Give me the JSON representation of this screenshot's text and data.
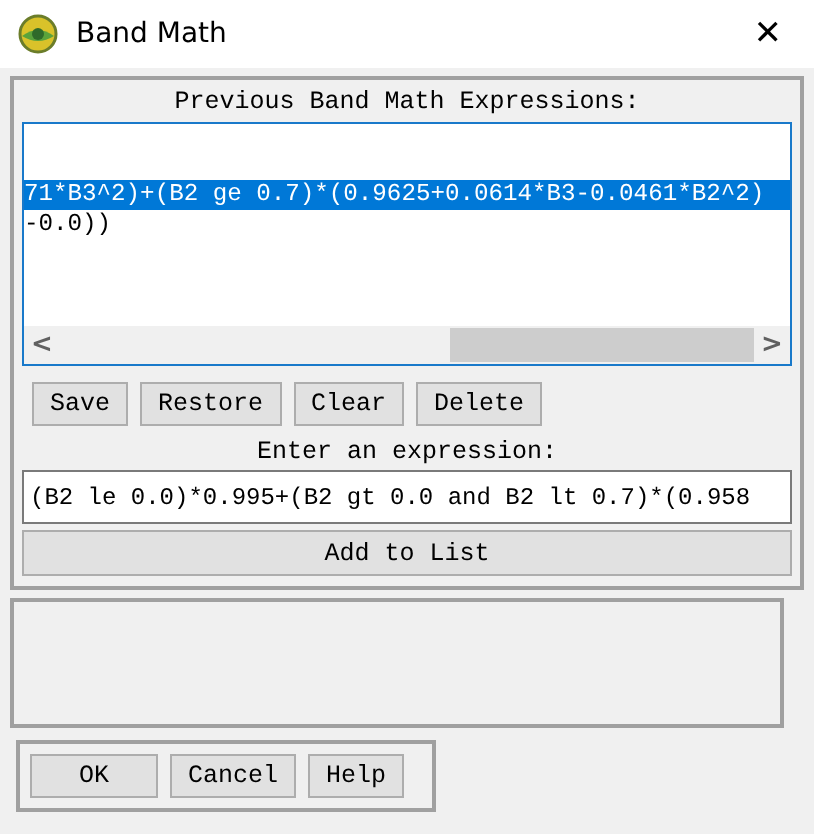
{
  "window": {
    "title": "Band Math",
    "close": "✕"
  },
  "history": {
    "heading": "Previous Band Math Expressions:",
    "items": [
      {
        "text": "71*B3^2)+(B2 ge 0.7)*(0.9625+0.0614*B3-0.0461*B2^2)",
        "selected": true
      },
      {
        "text": "-0.0))",
        "selected": false
      }
    ],
    "scroll_left": "<",
    "scroll_right": ">",
    "buttons": [
      "Save",
      "Restore",
      "Clear",
      "Delete"
    ]
  },
  "expression": {
    "label": "Enter an expression:",
    "value": "(B2 le 0.0)*0.995+(B2 gt 0.0 and B2 lt 0.7)*(0.958",
    "add_button": "Add to List"
  },
  "footer_buttons": [
    "OK",
    "Cancel",
    "Help"
  ]
}
